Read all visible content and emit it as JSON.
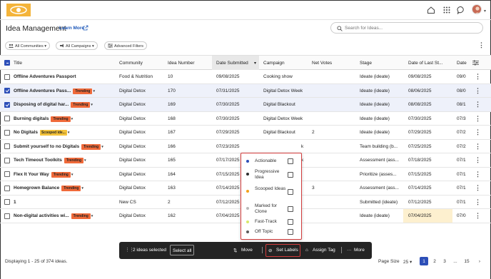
{
  "header": {
    "title": "Idea Management",
    "learn_more": "Learn More",
    "search_placeholder": "Search for Ideas..."
  },
  "filters": {
    "communities": "All Communities",
    "campaigns": "All Campaigns",
    "advanced": "Advanced Filters"
  },
  "columns": [
    "Title",
    "Community",
    "Idea Number",
    "Date Submitted",
    "Campaign",
    "Net Votes",
    "Stage",
    "Date of Last St...",
    "Date"
  ],
  "rows": [
    {
      "title": "Offline Adventures Passport",
      "tag": "",
      "community": "Food & Nutrition",
      "number": "10",
      "date": "09/08/2025",
      "campaign": "Cooking show",
      "votes": "",
      "stage": "Ideate (ideate)",
      "last": "09/08/2025",
      "last2": "09/0"
    },
    {
      "title": "Offline Adventures Pass...",
      "tag": "Trending",
      "community": "Digital Detox",
      "number": "170",
      "date": "07/31/2025",
      "campaign": "Digital Detox Week",
      "votes": "",
      "stage": "Ideate (ideate)",
      "last": "08/06/2025",
      "last2": "08/0"
    },
    {
      "title": "Disposing of digital har...",
      "tag": "Trending",
      "community": "Digital Detox",
      "number": "169",
      "date": "07/30/2025",
      "campaign": "Digital Blackout",
      "votes": "",
      "stage": "Ideate (ideate)",
      "last": "08/08/2025",
      "last2": "08/1"
    },
    {
      "title": "Burning digitals",
      "tag": "Trending",
      "community": "Digital Detox",
      "number": "168",
      "date": "07/30/2025",
      "campaign": "Digital Detox Week",
      "votes": "",
      "stage": "Ideate (ideate)",
      "last": "07/30/2025",
      "last2": "07/3"
    },
    {
      "title": "No Digitals",
      "tag": "Scooped ide...",
      "community": "Digital Detox",
      "number": "167",
      "date": "07/29/2025",
      "campaign": "Digital Blackout",
      "votes": "2",
      "stage": "Ideate (ideate)",
      "last": "07/29/2025",
      "last2": "07/2"
    },
    {
      "title": "Submit yourself to no Digitals",
      "tag": "Trending",
      "community": "Digital Detox",
      "number": "166",
      "date": "07/23/2025",
      "campaign": "k",
      "votes": "",
      "stage": "Team building (b...",
      "last": "07/25/2025",
      "last2": "07/2"
    },
    {
      "title": "Tech Timeout Toolkits",
      "tag": "Trending",
      "community": "Digital Detox",
      "number": "165",
      "date": "07/17/2025",
      "campaign": "k",
      "votes": "",
      "stage": "Assessment (ass...",
      "last": "07/18/2025",
      "last2": "07/1"
    },
    {
      "title": "Flex It Your Way",
      "tag": "Trending",
      "community": "Digital Detox",
      "number": "164",
      "date": "07/15/2025",
      "campaign": "",
      "votes": "",
      "stage": "Prioritize (asses...",
      "last": "07/15/2025",
      "last2": "07/1"
    },
    {
      "title": "Homegrown Balance",
      "tag": "Trending",
      "community": "Digital Detox",
      "number": "163",
      "date": "07/14/2025",
      "campaign": "",
      "votes": "3",
      "stage": "Assessment (ass...",
      "last": "07/14/2025",
      "last2": "07/1"
    },
    {
      "title": "1",
      "tag": "",
      "community": "New CS",
      "number": "2",
      "date": "07/12/2025",
      "campaign": "",
      "votes": "",
      "stage": "Submitted (ideate)",
      "last": "07/12/2025",
      "last2": "07/1"
    },
    {
      "title": "Non-digital activities wi...",
      "tag": "Trending",
      "community": "Digital Detox",
      "number": "162",
      "date": "07/04/2025",
      "campaign": "",
      "votes": "",
      "stage": "Ideate (ideate)",
      "last": "07/04/2025",
      "last2": "07/0"
    }
  ],
  "labels_popup": [
    {
      "label": "Actionable",
      "color": "#2d4fb8"
    },
    {
      "label": "Progressive Idea",
      "color": "#2e2e2e"
    },
    {
      "label": "Scooped Ideas",
      "color": "#f3a21a"
    },
    {
      "label": "Marked for Clone",
      "color": "#b9b9b9"
    },
    {
      "label": "Fast-Track",
      "color": "#d9e86a"
    },
    {
      "label": "Off Topic",
      "color": "#5a5a5a"
    }
  ],
  "bulk_bar": {
    "selected_text": "2 ideas selected",
    "select_all": "Select all",
    "move": "Move",
    "set_labels": "Set Labels",
    "assign_tag": "Assign Tag",
    "more": "More"
  },
  "footer": {
    "displaying": "Displaying 1 - 25 of 374 ideas.",
    "page_size_label": "Page Size",
    "page_size": "25",
    "pages": [
      "1",
      "2",
      "3",
      "...",
      "15"
    ]
  },
  "colors": {
    "accent": "#2d4fb8",
    "trending_tag": "#f06a3a",
    "scooped_tag": "#f3c23a",
    "highlight_border": "#d23c3c"
  },
  "icons": [
    "logo",
    "home-icon",
    "apps-grid-icon",
    "chat-icon",
    "search-icon",
    "filter-icon",
    "kebab-icon",
    "settings-sliders-icon"
  ]
}
